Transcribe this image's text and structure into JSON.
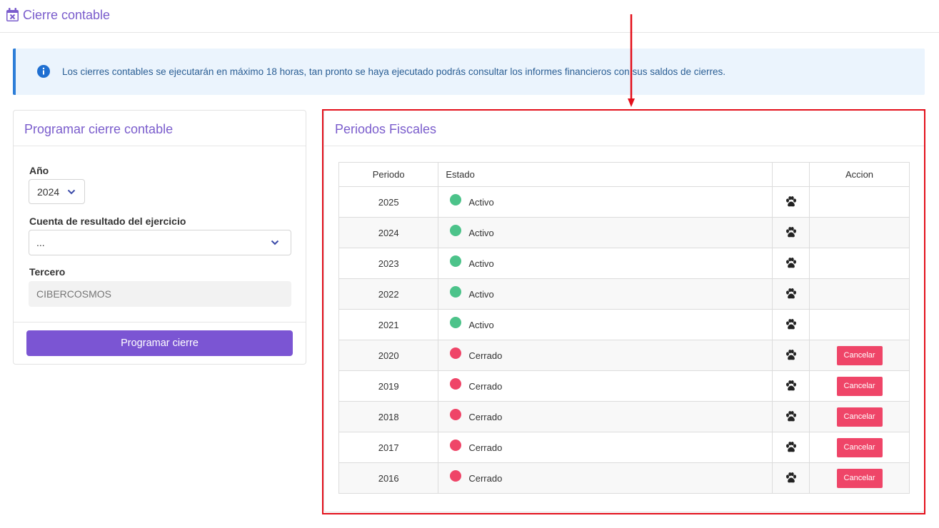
{
  "header": {
    "title": "Cierre contable",
    "icon": "calendar-x-icon"
  },
  "alert": {
    "icon": "info-circle-icon",
    "message": "Los cierres contables se ejecutarán en máximo 18 horas, tan pronto se haya ejecutado podrás consultar los informes financieros con sus saldos de cierres."
  },
  "form": {
    "title": "Programar cierre contable",
    "year_label": "Año",
    "year_value": "2024",
    "cuenta_label": "Cuenta de resultado del ejercicio",
    "cuenta_value": "...",
    "tercero_label": "Tercero",
    "tercero_placeholder": "CIBERCOSMOS",
    "submit_label": "Programar cierre"
  },
  "periods": {
    "title": "Periodos Fiscales",
    "columns": {
      "periodo": "Periodo",
      "estado": "Estado",
      "icon": "",
      "accion": "Accion"
    },
    "action_label": "Cancelar",
    "status_colors": {
      "Activo": "#4cc38a",
      "Cerrado": "#ef4568"
    },
    "row_icon": "paw-icon",
    "rows": [
      {
        "periodo": "2025",
        "estado": "Activo",
        "has_action": false
      },
      {
        "periodo": "2024",
        "estado": "Activo",
        "has_action": false
      },
      {
        "periodo": "2023",
        "estado": "Activo",
        "has_action": false
      },
      {
        "periodo": "2022",
        "estado": "Activo",
        "has_action": false
      },
      {
        "periodo": "2021",
        "estado": "Activo",
        "has_action": false
      },
      {
        "periodo": "2020",
        "estado": "Cerrado",
        "has_action": true
      },
      {
        "periodo": "2019",
        "estado": "Cerrado",
        "has_action": true
      },
      {
        "periodo": "2018",
        "estado": "Cerrado",
        "has_action": true
      },
      {
        "periodo": "2017",
        "estado": "Cerrado",
        "has_action": true
      },
      {
        "periodo": "2016",
        "estado": "Cerrado",
        "has_action": true
      }
    ]
  },
  "colors": {
    "accent": "#7a5ccc",
    "primary_button": "#7b55d3",
    "annotation": "#e3101b"
  }
}
